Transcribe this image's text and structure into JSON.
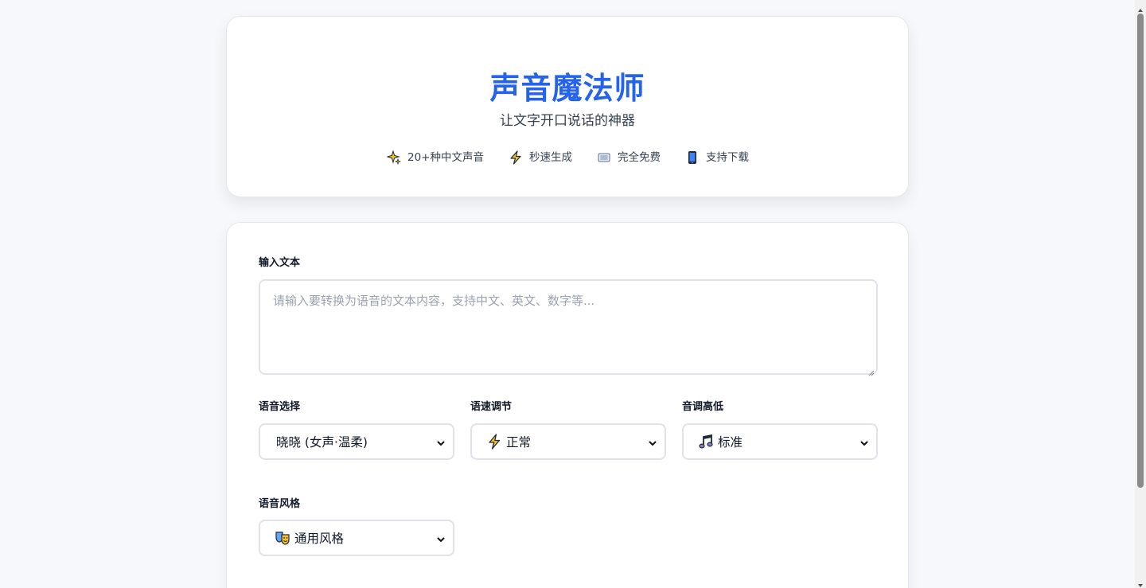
{
  "header": {
    "title": "声音魔法师",
    "subtitle": "让文字开口说话的神器",
    "features": [
      {
        "icon": "sparkles-icon",
        "label": "20+种中文声音"
      },
      {
        "icon": "lightning-icon",
        "label": "秒速生成"
      },
      {
        "icon": "free-icon",
        "label": "完全免费"
      },
      {
        "icon": "phone-icon",
        "label": "支持下载"
      }
    ]
  },
  "form": {
    "text_label": "输入文本",
    "text_placeholder": "请输入要转换为语音的文本内容，支持中文、英文、数字等...",
    "text_value": "",
    "voice_label": "语音选择",
    "voice_value": "晓晓 (女声·温柔)",
    "speed_label": "语速调节",
    "speed_value": "正常",
    "speed_icon": "lightning-icon",
    "pitch_label": "音调高低",
    "pitch_value": "标准",
    "pitch_icon": "music-note-icon",
    "style_label": "语音风格",
    "style_value": "通用风格",
    "style_icon": "theater-masks-icon"
  },
  "colors": {
    "accent": "#2563eb",
    "background": "#f7f8fb",
    "card": "#ffffff",
    "border": "#e0e3ea"
  }
}
